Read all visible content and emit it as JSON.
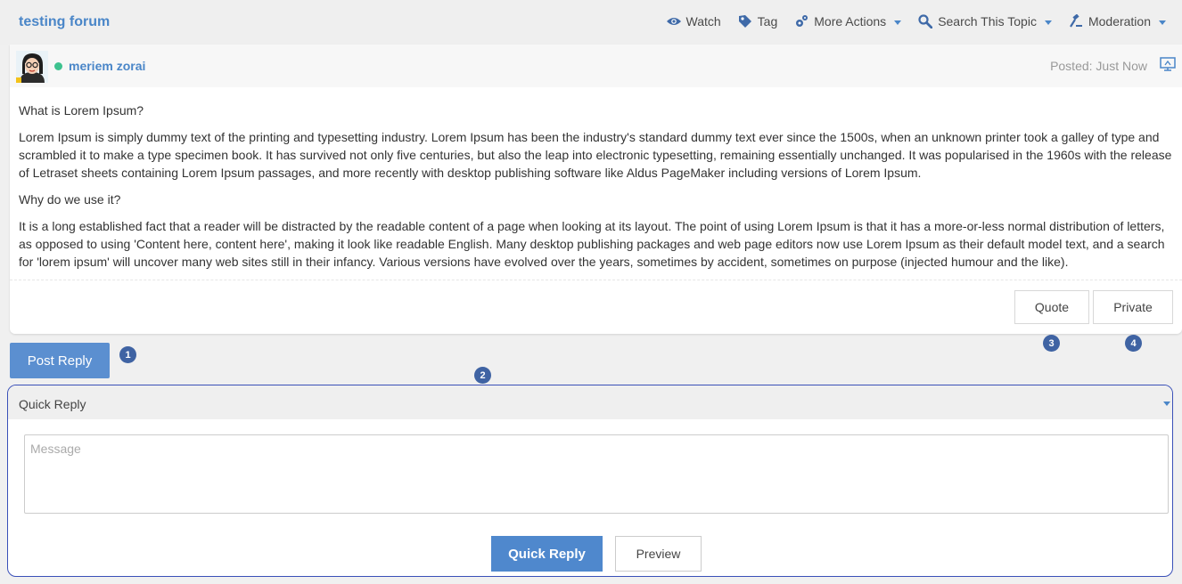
{
  "topic": {
    "title": "testing forum"
  },
  "actions": [
    {
      "label": "Watch",
      "icon": "eye-icon"
    },
    {
      "label": "Tag",
      "icon": "tag-icon"
    },
    {
      "label": "More Actions",
      "icon": "gears-icon"
    },
    {
      "label": "Search This Topic",
      "icon": "search-icon"
    },
    {
      "label": "Moderation",
      "icon": "gavel-icon"
    }
  ],
  "post": {
    "author": "meriem zorai",
    "status": "online",
    "posted": "Posted: Just Now",
    "paragraphs": [
      "What is Lorem Ipsum?",
      "Lorem Ipsum is simply dummy text of the printing and typesetting industry. Lorem Ipsum has been the industry's standard dummy text ever since the 1500s, when an unknown printer took a galley of type and scrambled it to make a type specimen book. It has survived not only five centuries, but also the leap into electronic typesetting, remaining essentially unchanged. It was popularised in the 1960s with the release of Letraset sheets containing Lorem Ipsum passages, and more recently with desktop publishing software like Aldus PageMaker including versions of Lorem Ipsum.",
      "Why do we use it?",
      "It is a long established fact that a reader will be distracted by the readable content of a page when looking at its layout. The point of using Lorem Ipsum is that it has a more-or-less normal distribution of letters, as opposed to using 'Content here, content here', making it look like readable English. Many desktop publishing packages and web page editors now use Lorem Ipsum as their default model text, and a search for 'lorem ipsum' will uncover many web sites still in their infancy. Various versions have evolved over the years, sometimes by accident, sometimes on purpose (injected humour and the like)."
    ],
    "quote_label": "Quote",
    "private_label": "Private"
  },
  "badges": [
    "1",
    "2",
    "3",
    "4"
  ],
  "post_reply_label": "Post Reply",
  "quick_reply": {
    "title": "Quick Reply",
    "placeholder": "Message",
    "submit_label": "Quick Reply",
    "preview_label": "Preview"
  },
  "colors": {
    "accent": "#4a86c8",
    "online": "#3ec28f",
    "badge": "#3f63a3",
    "panel_border": "#3a50b8"
  }
}
